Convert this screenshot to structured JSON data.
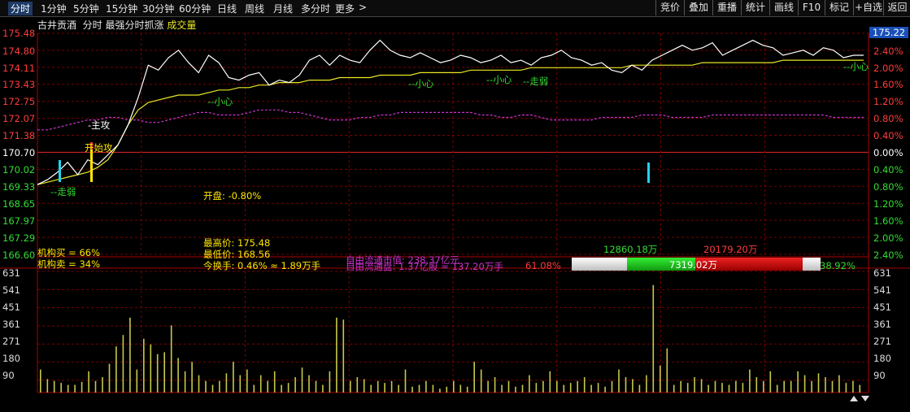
{
  "toolbar": {
    "tabs": [
      "分时",
      "1分钟",
      "5分钟",
      "15分钟",
      "30分钟",
      "60分钟",
      "日线",
      "周线",
      "月线",
      "多分时",
      "更多"
    ],
    "more_arrow": ">",
    "right_buttons": [
      "竞价",
      "叠加",
      "重播",
      "统计",
      "画线",
      "F10",
      "标记",
      "+自选",
      "返回"
    ]
  },
  "title": {
    "stock": "古井贡酒",
    "mode": "分时",
    "indicator": "最强分时抓涨",
    "volume_label": "成交量"
  },
  "price_axis": {
    "left": [
      "175.48",
      "174.80",
      "174.11",
      "173.43",
      "172.75",
      "172.07",
      "171.38",
      "170.70",
      "170.02",
      "169.33",
      "168.65",
      "167.97",
      "167.29",
      "166.60"
    ],
    "right": [
      "175.22",
      "2.40%",
      "2.00%",
      "1.60%",
      "1.20%",
      "0.80%",
      "0.40%",
      "0.00%",
      "0.40%",
      "0.80%",
      "1.20%",
      "1.60%",
      "2.00%",
      "2.40%"
    ],
    "current_price": "175.22"
  },
  "volume_axis": [
    "631",
    "541",
    "451",
    "361",
    "271",
    "180",
    "90"
  ],
  "chart_data": {
    "type": "line",
    "prev_close": 170.7,
    "ylim": [
      166.6,
      175.48
    ],
    "volume_ylim": [
      0,
      631
    ],
    "series": [
      {
        "name": "price",
        "values": [
          169.4,
          169.6,
          169.9,
          170.3,
          169.8,
          170.4,
          170.2,
          170.6,
          171.0,
          171.8,
          172.9,
          174.2,
          174.0,
          174.5,
          174.8,
          174.3,
          173.9,
          174.6,
          174.3,
          173.7,
          173.6,
          173.8,
          173.9,
          173.4,
          173.6,
          173.5,
          173.8,
          174.4,
          174.6,
          174.2,
          174.6,
          174.4,
          174.3,
          174.8,
          175.2,
          174.8,
          174.6,
          174.5,
          174.7,
          174.5,
          174.3,
          174.4,
          174.6,
          174.5,
          174.3,
          174.4,
          174.6,
          174.3,
          174.4,
          174.2,
          174.5,
          174.6,
          174.8,
          174.5,
          174.4,
          174.2,
          174.3,
          174.0,
          173.9,
          174.2,
          174.0,
          174.4,
          174.6,
          174.8,
          175.0,
          174.8,
          174.9,
          175.1,
          174.6,
          174.8,
          175.0,
          175.2,
          175.0,
          174.9,
          174.6,
          174.7,
          174.8,
          174.6,
          174.9,
          174.8,
          174.5,
          174.6,
          174.6
        ]
      },
      {
        "name": "avg",
        "values": [
          169.4,
          169.5,
          169.6,
          169.7,
          169.8,
          169.9,
          170.1,
          170.4,
          171.0,
          171.8,
          172.4,
          172.7,
          172.8,
          172.9,
          173.0,
          173.0,
          173.0,
          173.1,
          173.2,
          173.2,
          173.3,
          173.3,
          173.4,
          173.4,
          173.5,
          173.5,
          173.5,
          173.6,
          173.6,
          173.6,
          173.7,
          173.7,
          173.7,
          173.7,
          173.8,
          173.8,
          173.8,
          173.8,
          173.9,
          173.9,
          173.9,
          173.9,
          173.9,
          174.0,
          174.0,
          174.0,
          174.0,
          174.0,
          174.0,
          174.1,
          174.1,
          174.1,
          174.1,
          174.1,
          174.1,
          174.1,
          174.1,
          174.1,
          174.1,
          174.2,
          174.2,
          174.2,
          174.2,
          174.2,
          174.2,
          174.2,
          174.3,
          174.3,
          174.3,
          174.3,
          174.3,
          174.3,
          174.3,
          174.3,
          174.4,
          174.4,
          174.4,
          174.4,
          174.4,
          174.4,
          174.4,
          174.4,
          174.4
        ]
      },
      {
        "name": "ma",
        "values": [
          171.6,
          171.6,
          171.7,
          171.8,
          171.9,
          172.0,
          172.0,
          172.1,
          172.1,
          172.0,
          172.0,
          171.9,
          171.9,
          172.0,
          172.1,
          172.2,
          172.3,
          172.3,
          172.2,
          172.2,
          172.2,
          172.3,
          172.4,
          172.4,
          172.4,
          172.3,
          172.3,
          172.2,
          172.1,
          172.0,
          172.0,
          172.0,
          172.1,
          172.1,
          172.2,
          172.2,
          172.3,
          172.3,
          172.3,
          172.3,
          172.3,
          172.3,
          172.3,
          172.3,
          172.2,
          172.2,
          172.1,
          172.1,
          172.2,
          172.2,
          172.1,
          172.0,
          172.0,
          172.0,
          172.0,
          172.0,
          172.1,
          172.1,
          172.1,
          172.1,
          172.2,
          172.2,
          172.2,
          172.1,
          172.1,
          172.1,
          172.1,
          172.2,
          172.2,
          172.2,
          172.2,
          172.2,
          172.2,
          172.2,
          172.2,
          172.2,
          172.2,
          172.2,
          172.2,
          172.1,
          172.1,
          172.1,
          172.1
        ]
      }
    ],
    "volumes": [
      120,
      70,
      60,
      50,
      40,
      40,
      55,
      110,
      60,
      80,
      150,
      240,
      300,
      390,
      120,
      280,
      250,
      200,
      210,
      350,
      180,
      110,
      160,
      90,
      60,
      40,
      60,
      100,
      160,
      90,
      120,
      40,
      90,
      60,
      110,
      40,
      50,
      80,
      130,
      90,
      60,
      40,
      110,
      390,
      380,
      60,
      80,
      70,
      40,
      60,
      50,
      60,
      40,
      120,
      30,
      40,
      60,
      40,
      20,
      30,
      60,
      40,
      30,
      160,
      120,
      60,
      80,
      40,
      60,
      30,
      40,
      90,
      50,
      60,
      110,
      60,
      40,
      50,
      60,
      80,
      40,
      50,
      30,
      60,
      120,
      80,
      70,
      40,
      90,
      560,
      140,
      230,
      40,
      60,
      50,
      80,
      70,
      40,
      60,
      50,
      40,
      60,
      50,
      120,
      80,
      60,
      110,
      40,
      60,
      60,
      110,
      90,
      60,
      100,
      80,
      60,
      90,
      50,
      60,
      40
    ]
  },
  "annotations": {
    "zoubo_top": "走弱",
    "xiaoxin1": "小心",
    "xiaoxin2": "小心",
    "xiaoxin3": "小心",
    "xiaoxin4": "小心",
    "zoubo_mid": "走弱",
    "zhugong": "主攻",
    "kaishi": "开始攻",
    "zoubo_low": "走弱"
  },
  "info": {
    "kaipan": "开盘: -0.80%",
    "zuigao": "最高价: 175.48",
    "zuidi": "最低价: 168.56",
    "huanshou": "今换手: 0.46% ≈ 1.89万手",
    "jigou_buy": "机构买 = 66%",
    "jigou_sell": "机构卖 = 34%",
    "ziyou_shizhi": "自由流通市值: 238.37亿元",
    "ziyou_liutong": "自由流通盘: 1.37亿股 ≈ 137.20万手",
    "pct_red": "61.08%",
    "flow_green_top": "12860.18万",
    "flow_red_top": "20179.20万",
    "flow_mid": "7319.02万",
    "pct_green": "38.92%"
  },
  "colors": {
    "price_line": "#ffffff",
    "avg_line": "#e8e822",
    "ma_line": "#cc33cc",
    "grid": "#8b0000",
    "up": "#ff3b3b",
    "down": "#33dd33",
    "volume": "#c8c84a"
  }
}
